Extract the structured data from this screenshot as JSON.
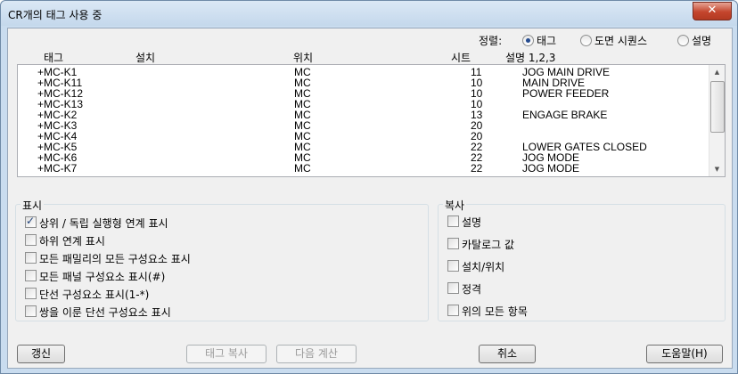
{
  "window": {
    "title": "CR개의 태그 사용 중",
    "close_label": "✕"
  },
  "sort": {
    "label": "정렬:",
    "options": [
      {
        "label": "태그",
        "checked": true
      },
      {
        "label": "도면 시퀀스",
        "checked": false
      },
      {
        "label": "설명",
        "checked": false
      }
    ]
  },
  "list": {
    "columns": [
      "태그",
      "설치",
      "위치",
      "시트",
      "설명 1,2,3"
    ],
    "rows": [
      {
        "tag": "+MC-K1",
        "install": "",
        "location": "MC",
        "sheet": "11",
        "desc": "JOG MAIN DRIVE"
      },
      {
        "tag": "+MC-K11",
        "install": "",
        "location": "MC",
        "sheet": "10",
        "desc": "MAIN DRIVE"
      },
      {
        "tag": "+MC-K12",
        "install": "",
        "location": "MC",
        "sheet": "10",
        "desc": "POWER FEEDER"
      },
      {
        "tag": "+MC-K13",
        "install": "",
        "location": "MC",
        "sheet": "10",
        "desc": ""
      },
      {
        "tag": "+MC-K2",
        "install": "",
        "location": "MC",
        "sheet": "13",
        "desc": "ENGAGE BRAKE"
      },
      {
        "tag": "+MC-K3",
        "install": "",
        "location": "MC",
        "sheet": "20",
        "desc": ""
      },
      {
        "tag": "+MC-K4",
        "install": "",
        "location": "MC",
        "sheet": "20",
        "desc": ""
      },
      {
        "tag": "+MC-K5",
        "install": "",
        "location": "MC",
        "sheet": "22",
        "desc": "LOWER GATES CLOSED"
      },
      {
        "tag": "+MC-K6",
        "install": "",
        "location": "MC",
        "sheet": "22",
        "desc": "JOG MODE"
      },
      {
        "tag": "+MC-K7",
        "install": "",
        "location": "MC",
        "sheet": "22",
        "desc": "JOG MODE"
      }
    ]
  },
  "display": {
    "title": "표시",
    "items": [
      {
        "label": "상위 / 독립 실행형 연계 표시",
        "checked": true
      },
      {
        "label": "하위 연계 표시",
        "checked": false
      },
      {
        "label": "모든 패밀리의 모든 구성요소 표시",
        "checked": false
      },
      {
        "label": "모든 패널 구성요소 표시(#)",
        "checked": false
      },
      {
        "label": "단선 구성요소 표시(1-*)",
        "checked": false
      },
      {
        "label": "쌍을 이룬 단선 구성요소 표시",
        "checked": false
      }
    ]
  },
  "copy": {
    "title": "복사",
    "items": [
      {
        "label": "설명",
        "checked": false
      },
      {
        "label": "카탈로그 값",
        "checked": false
      },
      {
        "label": "설치/위치",
        "checked": false
      },
      {
        "label": "정격",
        "checked": false
      },
      {
        "label": "위의 모든 항목",
        "checked": false
      }
    ]
  },
  "buttons": {
    "refresh": "갱신",
    "copy_tag": "태그 복사",
    "next_calc": "다음 계산",
    "cancel": "취소",
    "help": "도움말(H)"
  }
}
